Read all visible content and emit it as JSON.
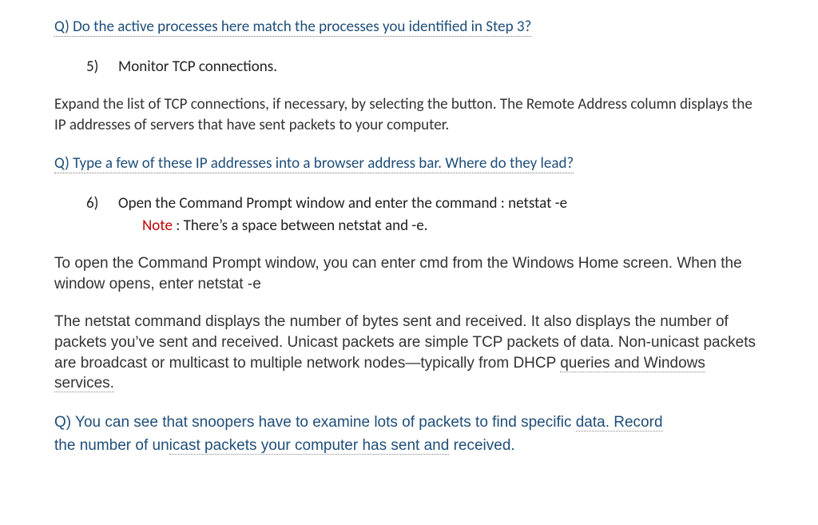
{
  "q1": {
    "text": "Q) Do the active processes here match the processes you identified in Step 3?"
  },
  "item5": {
    "number": "5)",
    "text": "Monitor TCP connections."
  },
  "para1": "Expand the list of TCP connections, if necessary, by selecting the button. The Remote Address column displays the IP addresses of servers that have sent packets to your computer.",
  "q2": {
    "text": "Q) Type a few of these IP addresses into a browser address bar. Where do they lead?"
  },
  "item6": {
    "number": "6)",
    "text": "Open the Command Prompt window and enter the command : netstat -e",
    "note_label": "Note",
    "note_text": " : There’s a space between netstat and -e."
  },
  "para2": "To open the Command Prompt window, you can enter cmd from the Windows Home screen. When the window opens, enter netstat -e",
  "para3_a": "The netstat command displays the number of bytes sent and received. It also displays the number of packets you’ve sent and received. Unicast packets are simple TCP packets of data. Non-unicast packets are broadcast or multicast to multiple network nodes—typically from DHCP ",
  "para3_b": "queries and Windows services.",
  "q3_a": "Q) You can see that snoopers have to examine lots of packets to find specific ",
  "q3_b": "data. Record ",
  "q3_c": "the number of un",
  "q3_d": "icast packets your computer has sent and",
  "q3_e": " received."
}
